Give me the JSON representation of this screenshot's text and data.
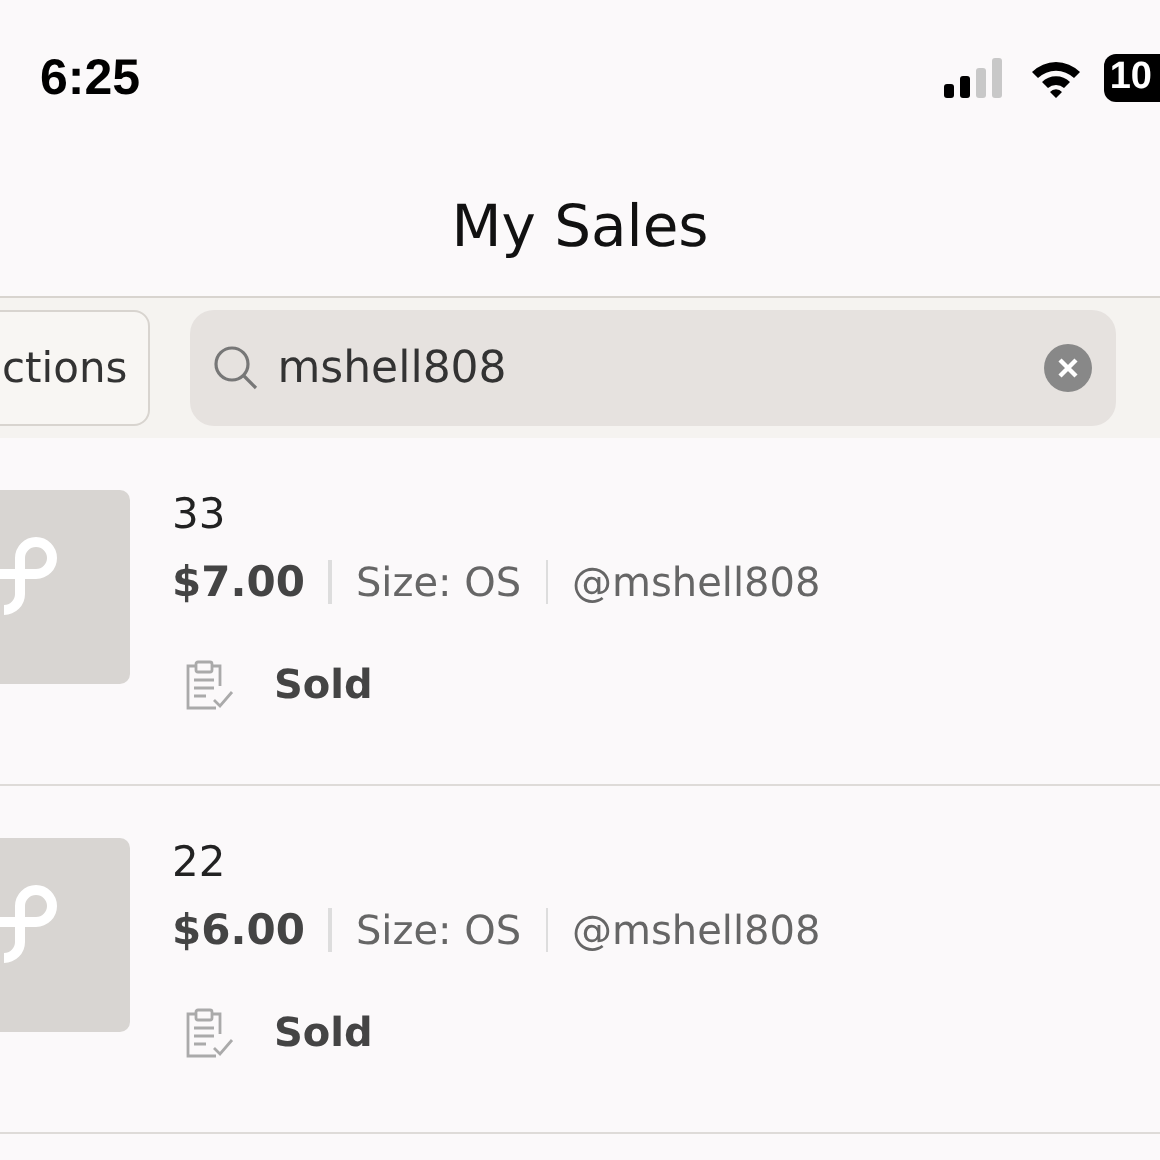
{
  "status_bar": {
    "time": "6:25",
    "battery": "10"
  },
  "header": {
    "title": "My Sales"
  },
  "filter_bar": {
    "button": "ctions",
    "search": {
      "value": "mshell808"
    }
  },
  "sales": [
    {
      "title": "33",
      "price": "$7.00",
      "size": "Size: OS",
      "buyer": "@mshell808",
      "status": "Sold"
    },
    {
      "title": "22",
      "price": "$6.00",
      "size": "Size: OS",
      "buyer": "@mshell808",
      "status": "Sold"
    }
  ]
}
